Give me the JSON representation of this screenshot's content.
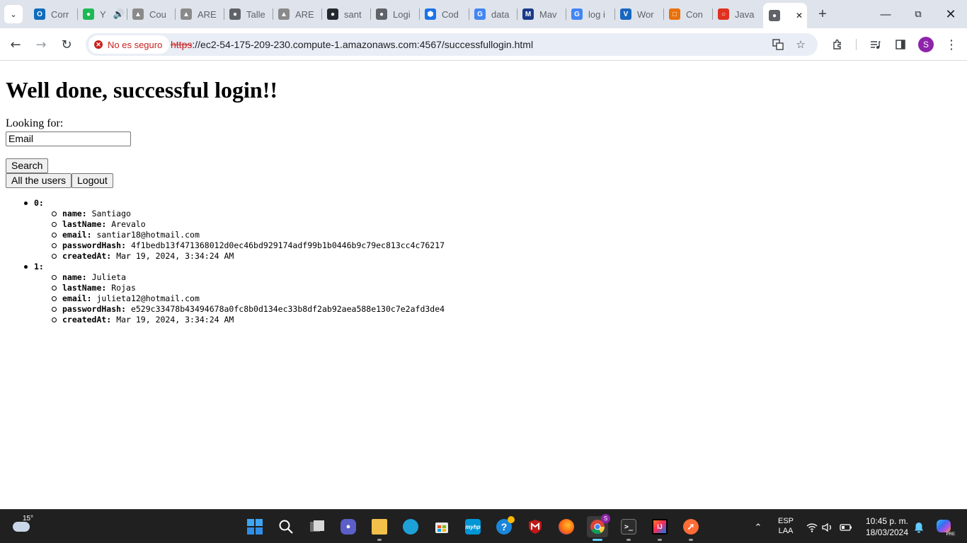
{
  "browser": {
    "tabs": [
      {
        "label": "Corr",
        "icon": "outlook-icon",
        "color": "#0f6cbd"
      },
      {
        "label": "Y",
        "icon": "spotify-icon",
        "color": "#1db954"
      },
      {
        "label": "Cou",
        "icon": "aws-academy-icon",
        "color": "#8a8a8a"
      },
      {
        "label": "ARE",
        "icon": "aws-academy-icon",
        "color": "#8a8a8a"
      },
      {
        "label": "Talle",
        "icon": "globe-icon",
        "color": "#5f6368"
      },
      {
        "label": "ARE",
        "icon": "aws-academy-icon",
        "color": "#8a8a8a"
      },
      {
        "label": "sant",
        "icon": "github-icon",
        "color": "#24292f"
      },
      {
        "label": "Logi",
        "icon": "globe-icon",
        "color": "#5f6368"
      },
      {
        "label": "Cod",
        "icon": "codedeploy-icon",
        "color": "#1a73e8"
      },
      {
        "label": "data",
        "icon": "google-icon",
        "color": "#4285f4"
      },
      {
        "label": "Mav",
        "icon": "maven-icon",
        "color": "#1a3a8a"
      },
      {
        "label": "log i",
        "icon": "google-icon",
        "color": "#4285f4"
      },
      {
        "label": "Wor",
        "icon": "vuetify-icon",
        "color": "#1867c0"
      },
      {
        "label": "Con",
        "icon": "aws-console-icon",
        "color": "#e8710a"
      },
      {
        "label": "Java",
        "icon": "oracle-icon",
        "color": "#e0301e"
      },
      {
        "label": "",
        "icon": "globe-icon",
        "color": "#5f6368",
        "active": true
      }
    ],
    "security_label": "No es seguro",
    "url_scheme": "https",
    "url_rest": "://ec2-54-175-209-230.compute-1.amazonaws.com:4567/successfullogin.html",
    "profile_initial": "S"
  },
  "page": {
    "heading": "Well done, successful login!!",
    "search_label": "Looking for:",
    "search_value": "Email",
    "search_button": "Search",
    "all_users_button": "All the users",
    "logout_button": "Logout",
    "users": [
      {
        "index": "0:",
        "fields": [
          {
            "key": "name:",
            "value": "Santiago"
          },
          {
            "key": "lastName:",
            "value": "Arevalo"
          },
          {
            "key": "email:",
            "value": "santiar18@hotmail.com"
          },
          {
            "key": "passwordHash:",
            "value": "4f1bedb13f471368012d0ec46bd929174adf99b1b0446b9c79ec813cc4c76217"
          },
          {
            "key": "createdAt:",
            "value": "Mar 19, 2024, 3:34:24 AM"
          }
        ]
      },
      {
        "index": "1:",
        "fields": [
          {
            "key": "name:",
            "value": "Julieta"
          },
          {
            "key": "lastName:",
            "value": "Rojas"
          },
          {
            "key": "email:",
            "value": "julieta12@hotmail.com"
          },
          {
            "key": "passwordHash:",
            "value": "e529c33478b43494678a0fc8b0d134ec33b8df2ab92aea588e130c7e2afd3de4"
          },
          {
            "key": "createdAt:",
            "value": "Mar 19, 2024, 3:34:24 AM"
          }
        ]
      }
    ]
  },
  "taskbar": {
    "weather_temp": "15°",
    "language": "ESP",
    "keyboard": "LAA",
    "time": "10:45 p. m.",
    "date": "18/03/2024",
    "chrome_badge": "S",
    "intellij_label": "IJ",
    "hp_label": "myhp",
    "copilot_badge": "PRE"
  }
}
